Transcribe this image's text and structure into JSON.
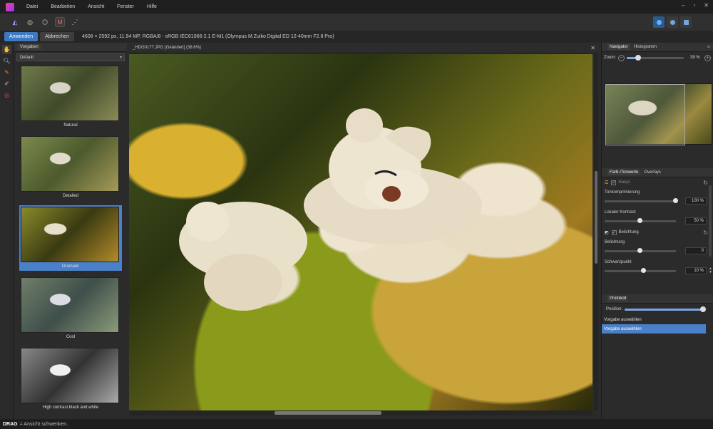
{
  "menu": [
    "Datei",
    "Bearbeiten",
    "Ansicht",
    "Fenster",
    "Hilfe"
  ],
  "window_controls": [
    "–",
    "▫",
    "✕"
  ],
  "context": {
    "apply": "Anwenden",
    "cancel": "Abbrechen",
    "info": "4608 × 2592 px, 11.94 MP, RGBA/8 - sRGB IEC61966-2.1     E-M1 (Olympus M.Zuiko Digital ED 12-40mm F2.8 Pro)"
  },
  "presets_panel": {
    "tab": "Vorgaben",
    "dropdown": "Default",
    "items": [
      {
        "label": "Natural"
      },
      {
        "label": "Detailed"
      },
      {
        "label": "Dramatic"
      },
      {
        "label": "Cool"
      },
      {
        "label": "High contrast black and white"
      }
    ],
    "selected": "Dramatic"
  },
  "document": {
    "tab": "_HDG0177.JPG [Geändert] (38.6%)"
  },
  "navigator": {
    "tabs": [
      "Navigator",
      "Histogramm"
    ],
    "zoom_label": "Zoom:",
    "zoom_value": "39 %",
    "zoom_fraction": 0.2
  },
  "tone": {
    "tabs": [
      "Farb-/Tonwerte",
      "Overlays"
    ],
    "main_label": "Haupt",
    "params1": [
      {
        "label": "Tonkomprimierung",
        "value": "100 %",
        "fraction": 1.0
      },
      {
        "label": "Lokaler Kontrast",
        "value": "50 %",
        "fraction": 0.5
      }
    ],
    "exposure_label": "Belichtung",
    "params2": [
      {
        "label": "Belichtung",
        "value": "0",
        "fraction": 0.5
      },
      {
        "label": "Schwarzpunkt",
        "value": "10 %",
        "fraction": 0.55
      }
    ]
  },
  "history": {
    "tab": "Protokoll",
    "position_label": "Position:",
    "position_fraction": 1.0,
    "items": [
      "Vorgabe auswählen",
      "Vorgabe auswählen"
    ]
  },
  "status": {
    "key": "DRAG",
    "text": "= Ansicht schwenken."
  }
}
